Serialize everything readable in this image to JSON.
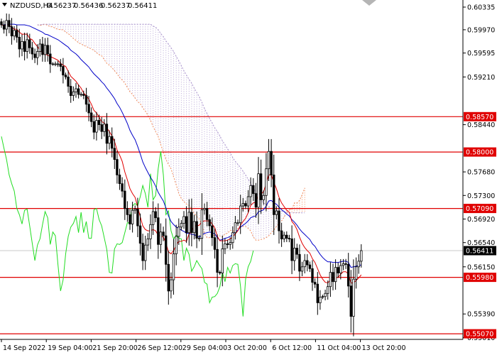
{
  "header": {
    "symbol_label": "NZDUSD,H4",
    "ohlc": [
      "0.56237",
      "0.56436",
      "0.56237",
      "0.56411"
    ]
  },
  "chart_data": {
    "type": "candlestick",
    "symbol": "NZDUSD",
    "timeframe": "H4",
    "ylim": [
      0.5498,
      0.6045
    ],
    "y_ticks": [
      "0.60335",
      "0.59970",
      "0.59595",
      "0.59210",
      "0.58440",
      "0.57680",
      "0.57300",
      "0.56920",
      "0.56540",
      "0.56150",
      "0.55390",
      "0.55010"
    ],
    "x_ticks": [
      "14 Sep 2022",
      "19 Sep 04:00",
      "21 Sep 20:00",
      "26 Sep 12:00",
      "29 Sep 04:00",
      "3 Oct 20:00",
      "6 Oct 12:00",
      "11 Oct 04:00",
      "13 Oct 20:00"
    ],
    "current_price": "0.56411",
    "horizontal_levels": [
      {
        "label": "0.58570",
        "value": 0.5857
      },
      {
        "label": "0.58000",
        "value": 0.58
      },
      {
        "label": "0.57090",
        "value": 0.5709
      },
      {
        "label": "0.55980",
        "value": 0.5598
      },
      {
        "label": "0.55070",
        "value": 0.5507
      }
    ],
    "candles_close": [
      0.6005,
      0.5998,
      0.6012,
      0.6002,
      0.5987,
      0.5996,
      0.5985,
      0.5966,
      0.5978,
      0.5962,
      0.5981,
      0.5968,
      0.5958,
      0.5952,
      0.5962,
      0.5974,
      0.5957,
      0.5972,
      0.5958,
      0.5942,
      0.5942,
      0.5942,
      0.5942,
      0.5938,
      0.5924,
      0.5921,
      0.5906,
      0.5891,
      0.5897,
      0.5902,
      0.5893,
      0.5893,
      0.5891,
      0.5877,
      0.5863,
      0.5849,
      0.5832,
      0.5851,
      0.5844,
      0.5833,
      0.5845,
      0.5814,
      0.5825,
      0.5806,
      0.5788,
      0.5763,
      0.5749,
      0.5737,
      0.5709,
      0.5699,
      0.5684,
      0.5706,
      0.5708,
      0.5681,
      0.5653,
      0.5625,
      0.565,
      0.566,
      0.5683,
      0.5704,
      0.5694,
      0.5651,
      0.5671,
      0.5665,
      0.5619,
      0.5576,
      0.5594,
      0.5636,
      0.5664,
      0.5679,
      0.5685,
      0.5696,
      0.567,
      0.5703,
      0.567,
      0.5688,
      0.5661,
      0.5661,
      0.5707,
      0.5709,
      0.5691,
      0.5681,
      0.5662,
      0.5643,
      0.5606,
      0.5605,
      0.5644,
      0.5652,
      0.5651,
      0.5654,
      0.567,
      0.5686,
      0.5686,
      0.5713,
      0.5717,
      0.5713,
      0.5728,
      0.5746,
      0.5733,
      0.5711,
      0.5765,
      0.5723,
      0.573,
      0.5773,
      0.5801,
      0.5763,
      0.5699,
      0.5705,
      0.5673,
      0.566,
      0.5666,
      0.5661,
      0.566,
      0.5625,
      0.5645,
      0.5635,
      0.5608,
      0.5615,
      0.5625,
      0.5618,
      0.5612,
      0.559,
      0.5587,
      0.5557,
      0.5566,
      0.5567,
      0.5572,
      0.5583,
      0.5606,
      0.5591,
      0.5614,
      0.5605,
      0.5617,
      0.562,
      0.5619,
      0.5584,
      0.5535,
      0.5595,
      0.5615,
      0.5624,
      0.5641
    ],
    "tenkan": [
      0.6005,
      0.6004,
      0.6005,
      0.6005,
      0.6001,
      0.5998,
      0.5998,
      0.5993,
      0.599,
      0.599,
      0.599,
      0.5983,
      0.5981,
      0.5975,
      0.597,
      0.5964,
      0.596,
      0.5958,
      0.5956,
      0.5954,
      0.5952,
      0.595,
      0.5948,
      0.5943,
      0.594,
      0.5938,
      0.593,
      0.5922,
      0.5918,
      0.5914,
      0.5908,
      0.5903,
      0.5895,
      0.5891,
      0.5885,
      0.5877,
      0.5867,
      0.5863,
      0.5856,
      0.5849,
      0.5847,
      0.5839,
      0.5833,
      0.5826,
      0.5817,
      0.5803,
      0.5795,
      0.5785,
      0.5768,
      0.5755,
      0.5741,
      0.5733,
      0.5727,
      0.5712,
      0.5696,
      0.5681,
      0.5675,
      0.5673,
      0.5673,
      0.5675,
      0.5673,
      0.5666,
      0.5664,
      0.5663,
      0.5653,
      0.5639,
      0.5636,
      0.5641,
      0.565,
      0.5656,
      0.5656,
      0.5658,
      0.5656,
      0.5668,
      0.5671,
      0.5681,
      0.5681,
      0.5682,
      0.5688,
      0.5689,
      0.5689,
      0.5689,
      0.5684,
      0.5678,
      0.5664,
      0.5657,
      0.5657,
      0.5657,
      0.5658,
      0.566,
      0.5663,
      0.5668,
      0.5673,
      0.5682,
      0.5688,
      0.5693,
      0.5702,
      0.5714,
      0.5718,
      0.5719,
      0.5733,
      0.5732,
      0.5736,
      0.5749,
      0.5763,
      0.5763,
      0.5751,
      0.5741,
      0.5727,
      0.5718,
      0.5712,
      0.5706,
      0.5703,
      0.5688,
      0.5683,
      0.5675,
      0.5663,
      0.5653,
      0.5646,
      0.5641,
      0.5637,
      0.5628,
      0.5622,
      0.5612,
      0.5602,
      0.5595,
      0.559,
      0.5589,
      0.5594,
      0.5594,
      0.5597,
      0.5598,
      0.5603,
      0.5607,
      0.5607,
      0.5603,
      0.5589,
      0.5589,
      0.5593,
      0.5597,
      0.5602
    ],
    "kijun": [
      0.6005,
      0.6005,
      0.6006,
      0.6006,
      0.6006,
      0.6006,
      0.6005,
      0.6005,
      0.6005,
      0.6005,
      0.6004,
      0.6003,
      0.6001,
      0.5999,
      0.5997,
      0.5995,
      0.5993,
      0.599,
      0.5989,
      0.5987,
      0.5985,
      0.5983,
      0.5981,
      0.5978,
      0.5975,
      0.5972,
      0.5969,
      0.5964,
      0.5961,
      0.5958,
      0.5954,
      0.5949,
      0.5945,
      0.5941,
      0.5937,
      0.5931,
      0.5926,
      0.5922,
      0.5918,
      0.5913,
      0.5909,
      0.5903,
      0.5898,
      0.5892,
      0.5886,
      0.5878,
      0.5872,
      0.5864,
      0.5855,
      0.5846,
      0.5835,
      0.5827,
      0.582,
      0.5809,
      0.5797,
      0.5784,
      0.5775,
      0.5767,
      0.5759,
      0.5753,
      0.5745,
      0.5735,
      0.5728,
      0.5721,
      0.571,
      0.5697,
      0.5688,
      0.5683,
      0.5679,
      0.5677,
      0.5674,
      0.5672,
      0.5669,
      0.5669,
      0.5667,
      0.5667,
      0.5664,
      0.5663,
      0.5666,
      0.5669,
      0.567,
      0.5671,
      0.567,
      0.5668,
      0.5662,
      0.5658,
      0.5659,
      0.5661,
      0.5662,
      0.5664,
      0.5667,
      0.5671,
      0.5674,
      0.5679,
      0.5682,
      0.5685,
      0.5689,
      0.5694,
      0.5696,
      0.5697,
      0.5704,
      0.5705,
      0.5707,
      0.5713,
      0.5721,
      0.5722,
      0.5718,
      0.5716,
      0.5711,
      0.5707,
      0.5704,
      0.57,
      0.5697,
      0.5691,
      0.5687,
      0.5682,
      0.5676,
      0.5671,
      0.5667,
      0.5663,
      0.5659,
      0.5652,
      0.5648,
      0.5641,
      0.5635,
      0.563,
      0.5626,
      0.5623,
      0.5623,
      0.5622,
      0.5622,
      0.5622,
      0.5623,
      0.5624,
      0.5624,
      0.5622,
      0.5614,
      0.5615,
      0.5616,
      0.5617,
      0.5618
    ],
    "chikou": [
      0.5825,
      0.5806,
      0.5788,
      0.5763,
      0.5749,
      0.5737,
      0.5709,
      0.5699,
      0.5684,
      0.5706,
      0.5708,
      0.5681,
      0.5653,
      0.5625,
      0.565,
      0.566,
      0.5683,
      0.5704,
      0.5694,
      0.5651,
      0.5671,
      0.5665,
      0.5619,
      0.5576,
      0.5594,
      0.5636,
      0.5664,
      0.5679,
      0.5685,
      0.5696,
      0.567,
      0.5703,
      0.567,
      0.5688,
      0.5661,
      0.5661,
      0.5707,
      0.5709,
      0.5691,
      0.5681,
      0.5662,
      0.5643,
      0.5606,
      0.5605,
      0.5644,
      0.5652,
      0.5651,
      0.5654,
      0.567,
      0.5686,
      0.5686,
      0.5713,
      0.5717,
      0.5713,
      0.5728,
      0.5746,
      0.5733,
      0.5711,
      0.5765,
      0.5723,
      0.573,
      0.5773,
      0.5801,
      0.5763,
      0.5699,
      0.5705,
      0.5673,
      0.566,
      0.5666,
      0.5661,
      0.566,
      0.5625,
      0.5645,
      0.5635,
      0.5608,
      0.5615,
      0.5625,
      0.5618,
      0.5612,
      0.559,
      0.5587,
      0.5557,
      0.5566,
      0.5567,
      0.5572,
      0.5583,
      0.5606,
      0.5591,
      0.5614,
      0.5605,
      0.5617,
      0.562,
      0.5619,
      0.5584,
      0.5535,
      0.5595,
      0.5615,
      0.5624,
      0.5641
    ],
    "cloud": {
      "span_a": [
        0.6005,
        0.6004,
        0.6005,
        0.6006,
        0.6004,
        0.6002,
        0.6002,
        0.5999,
        0.5998,
        0.5997,
        0.5997,
        0.5993,
        0.5991,
        0.5987,
        0.5983,
        0.598,
        0.5976,
        0.5974,
        0.5972,
        0.597,
        0.5968,
        0.5966,
        0.5964,
        0.596,
        0.5957,
        0.5955,
        0.5949,
        0.5943,
        0.594,
        0.5936,
        0.5931,
        0.5926,
        0.592,
        0.5916,
        0.5911,
        0.5904,
        0.5897,
        0.5893,
        0.5887,
        0.5881,
        0.5878,
        0.5871,
        0.5866,
        0.5859,
        0.5851,
        0.5841,
        0.5833,
        0.5825,
        0.5812,
        0.58,
        0.5788,
        0.578,
        0.5773,
        0.576,
        0.5747,
        0.5733,
        0.5725,
        0.572,
        0.5716,
        0.5714,
        0.5709,
        0.5701,
        0.5696,
        0.5692,
        0.5682,
        0.5668,
        0.5662,
        0.5662,
        0.5665,
        0.5666,
        0.5665,
        0.5665,
        0.5663,
        0.5668,
        0.5669,
        0.5674,
        0.5673,
        0.5672,
        0.5677,
        0.5679,
        0.568,
        0.568,
        0.5677,
        0.5673,
        0.5663,
        0.5658,
        0.5658,
        0.5659,
        0.566,
        0.5662,
        0.5665,
        0.567,
        0.5674,
        0.568,
        0.5685,
        0.5689,
        0.5695,
        0.5704,
        0.5707,
        0.5708,
        0.5718,
        0.5718,
        0.5722,
        0.5731,
        0.5742
      ],
      "span_b": [
        0.6005,
        0.6005,
        0.6006,
        0.6006,
        0.6006,
        0.6006,
        0.6006,
        0.6006,
        0.6006,
        0.6006,
        0.6006,
        0.6006,
        0.6006,
        0.6006,
        0.6006,
        0.6006,
        0.6006,
        0.6006,
        0.6006,
        0.6006,
        0.6006,
        0.6006,
        0.6006,
        0.6006,
        0.6006,
        0.6006,
        0.6006,
        0.6006,
        0.6006,
        0.6006,
        0.6006,
        0.6006,
        0.6006,
        0.6006,
        0.6006,
        0.6006,
        0.6006,
        0.6006,
        0.6006,
        0.6006,
        0.6006,
        0.6006,
        0.6006,
        0.6006,
        0.6006,
        0.6003,
        0.6001,
        0.5997,
        0.5991,
        0.5986,
        0.5979,
        0.5974,
        0.5968,
        0.5962,
        0.5954,
        0.5947,
        0.5939,
        0.5931,
        0.5924,
        0.5917,
        0.5911,
        0.5903,
        0.5896,
        0.5889,
        0.588,
        0.587,
        0.5862,
        0.5854,
        0.5847,
        0.5839,
        0.5833,
        0.5826,
        0.5818,
        0.5812,
        0.5805,
        0.5799,
        0.5791,
        0.5785,
        0.578,
        0.5775,
        0.5769,
        0.5763,
        0.5756,
        0.575,
        0.5742,
        0.5735,
        0.5728,
        0.5722,
        0.5718,
        0.5715,
        0.5712,
        0.571,
        0.5707,
        0.5707,
        0.5705,
        0.5705,
        0.5704,
        0.5702,
        0.5702,
        0.5702,
        0.5702,
        0.5702,
        0.5702,
        0.5702,
        0.5702
      ]
    }
  }
}
